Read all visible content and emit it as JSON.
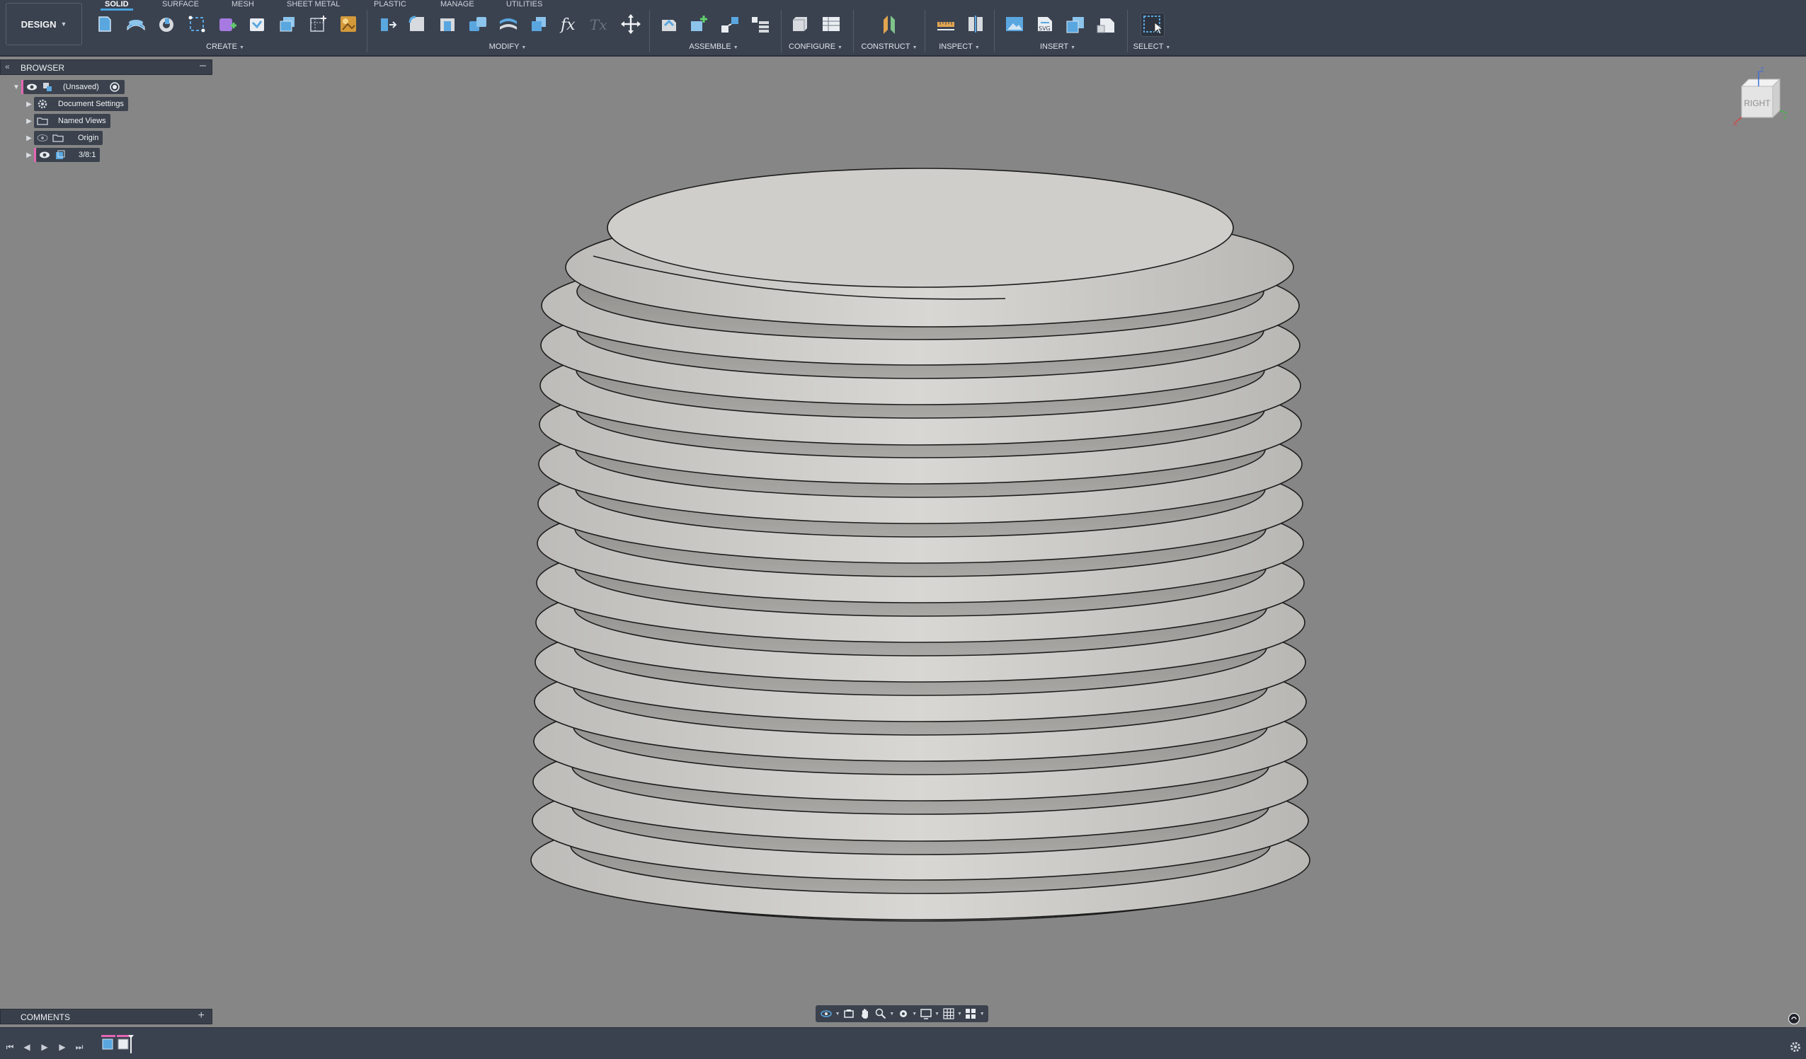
{
  "workspace": {
    "label": "DESIGN"
  },
  "tabs": [
    {
      "label": "SOLID",
      "active": true
    },
    {
      "label": "SURFACE"
    },
    {
      "label": "MESH"
    },
    {
      "label": "SHEET METAL"
    },
    {
      "label": "PLASTIC"
    },
    {
      "label": "MANAGE"
    },
    {
      "label": "UTILITIES"
    }
  ],
  "groups": {
    "create": "CREATE",
    "modify": "MODIFY",
    "assemble": "ASSEMBLE",
    "configure": "CONFIGURE",
    "construct": "CONSTRUCT",
    "inspect": "INSPECT",
    "insert": "INSERT",
    "select": "SELECT"
  },
  "browser": {
    "title": "BROWSER",
    "root": "(Unsaved)",
    "items": [
      {
        "label": "Document Settings",
        "icon": "gear-icon"
      },
      {
        "label": "Named Views",
        "icon": "folder-icon"
      },
      {
        "label": "Origin",
        "icon": "folder-icon"
      },
      {
        "label": "3/8:1",
        "icon": "component-icon"
      }
    ]
  },
  "viewcube": {
    "face": "RIGHT",
    "axis_z": "Z",
    "axis_x": "X",
    "axis_y": "Y"
  },
  "comments": {
    "title": "COMMENTS"
  },
  "colors": {
    "toolbar_bg": "#3a4250",
    "viewport_bg": "#868686",
    "accent": "#4aa3df",
    "active_component": "#e466b3"
  }
}
